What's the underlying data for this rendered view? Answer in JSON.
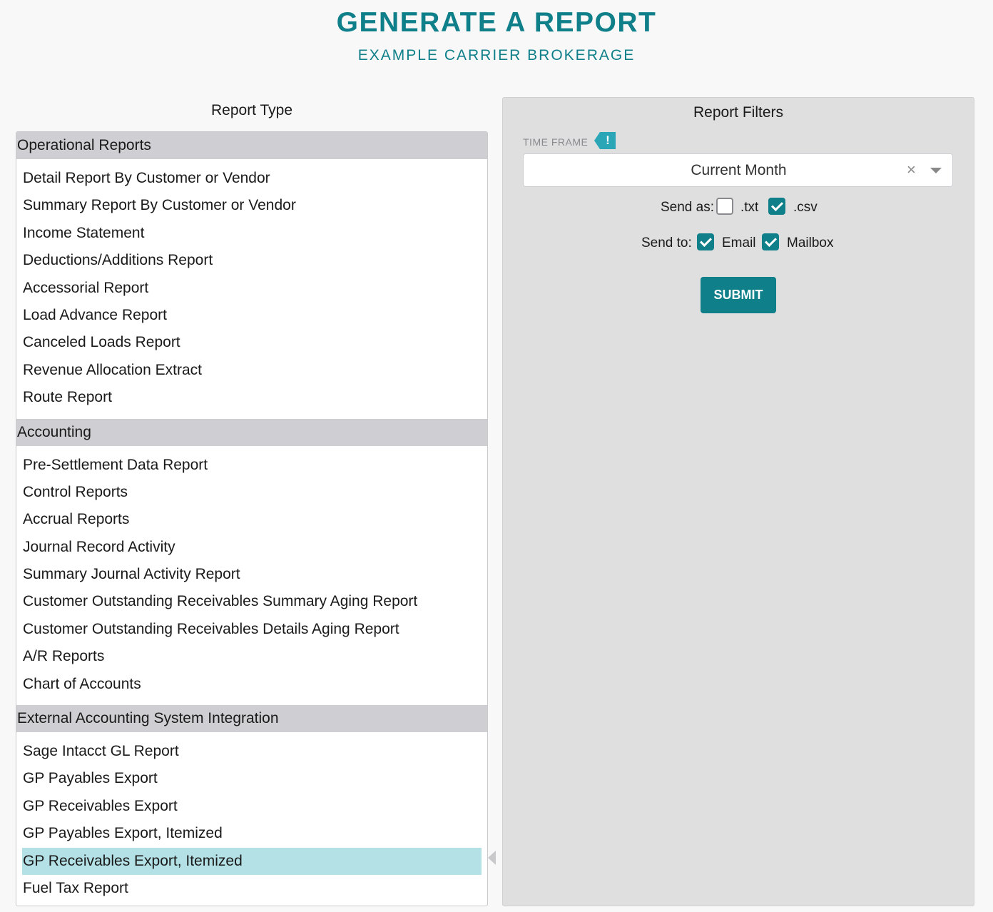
{
  "header": {
    "title": "GENERATE A REPORT",
    "subtitle": "EXAMPLE CARRIER BROKERAGE"
  },
  "report_type": {
    "title": "Report Type",
    "groups": [
      {
        "label": "Operational Reports",
        "items": [
          "Detail Report By Customer or Vendor",
          "Summary Report By Customer or Vendor",
          "Income Statement",
          "Deductions/Additions Report",
          "Accessorial Report",
          "Load Advance Report",
          "Canceled Loads Report",
          "Revenue Allocation Extract",
          "Route Report"
        ]
      },
      {
        "label": "Accounting",
        "items": [
          "Pre-Settlement Data Report",
          "Control Reports",
          "Accrual Reports",
          "Journal Record Activity",
          "Summary Journal Activity Report",
          "Customer Outstanding Receivables Summary Aging Report",
          "Customer Outstanding Receivables Details Aging Report",
          "A/R Reports",
          "Chart of Accounts"
        ]
      },
      {
        "label": "External Accounting System Integration",
        "items": [
          "Sage Intacct GL Report",
          "GP Payables Export",
          "GP Receivables Export",
          "GP Payables Export, Itemized",
          "GP Receivables Export, Itemized",
          "Fuel Tax Report"
        ]
      }
    ],
    "selected": "GP Receivables Export, Itemized"
  },
  "filters": {
    "title": "Report Filters",
    "time_frame_label": "TIME FRAME",
    "time_frame_alert": "!",
    "time_frame_value": "Current Month",
    "clear_symbol": "×",
    "send_as_label": "Send as:",
    "send_as_txt": ".txt",
    "send_as_txt_checked": false,
    "send_as_csv": ".csv",
    "send_as_csv_checked": true,
    "send_to_label": "Send to:",
    "send_to_email": "Email",
    "send_to_email_checked": true,
    "send_to_mailbox": "Mailbox",
    "send_to_mailbox_checked": true,
    "submit_label": "SUBMIT"
  },
  "colors": {
    "accent": "#0f7f8a",
    "selected_row": "#b3e1e6",
    "group_header": "#cfcfd3",
    "alert": "#2aa6b6"
  }
}
